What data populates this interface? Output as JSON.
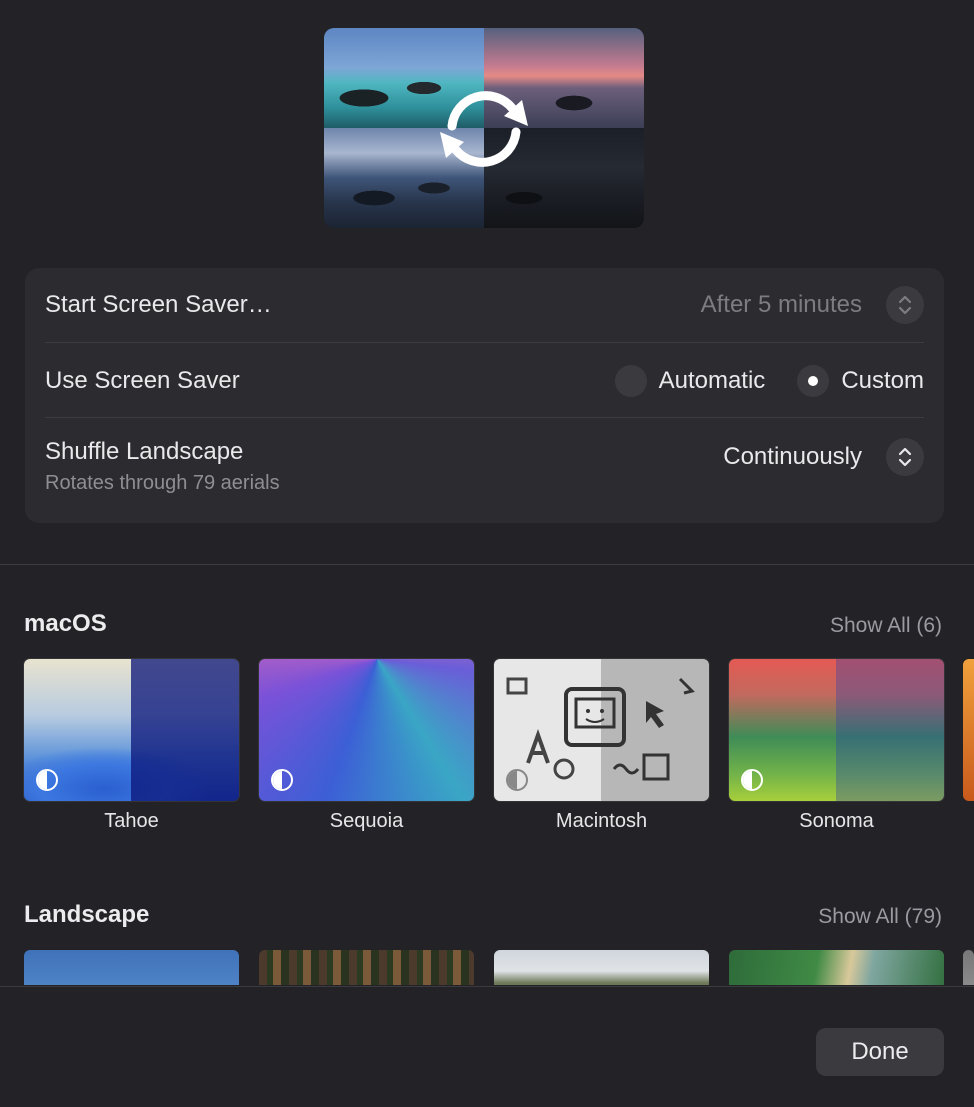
{
  "settings": {
    "start_label": "Start Screen Saver…",
    "start_value": "After 5 minutes",
    "use_label": "Use Screen Saver",
    "option_automatic": "Automatic",
    "option_custom": "Custom",
    "selected_option": "Custom",
    "shuffle_label": "Shuffle Landscape",
    "shuffle_sublabel": "Rotates through 79 aerials",
    "shuffle_value": "Continuously"
  },
  "macos": {
    "title": "macOS",
    "show_all": "Show All (6)",
    "items": [
      {
        "label": "Tahoe"
      },
      {
        "label": "Sequoia"
      },
      {
        "label": "Macintosh"
      },
      {
        "label": "Sonoma"
      }
    ]
  },
  "landscape": {
    "title": "Landscape",
    "show_all": "Show All (79)"
  },
  "footer": {
    "done_label": "Done"
  },
  "icons": {
    "preview_overlay": "shuffle-arrows-icon",
    "stepper": "chevron-up-down-icon",
    "badge": "dynamic-wallpaper-icon"
  }
}
